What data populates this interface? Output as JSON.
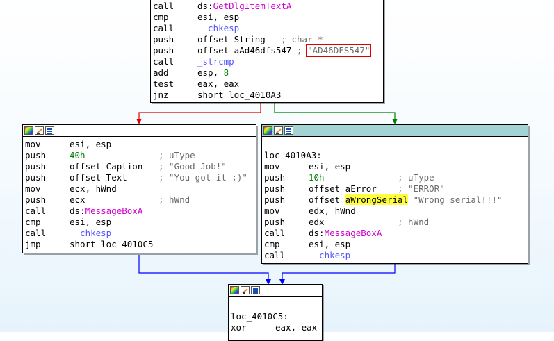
{
  "top_block": {
    "lines": [
      {
        "mn": "call",
        "op": "ds:",
        "opfn": "GetDlgItemTextA"
      },
      {
        "mn": "cmp",
        "op": "esi, esp"
      },
      {
        "mn": "call",
        "oplnk": "__chkesp"
      },
      {
        "mn": "push",
        "op": "offset String   ",
        "cm": "; char *"
      },
      {
        "mn": "push",
        "op": "offset aAd46dfs547 ",
        "cm": ";",
        "cm2": "\"AD46DFS547\""
      },
      {
        "mn": "call",
        "oplnk": "_strcmp"
      },
      {
        "mn": "add",
        "op": "esp, ",
        "num": "8"
      },
      {
        "mn": "test",
        "op": "eax, eax"
      },
      {
        "mn": "jnz",
        "op": "short loc_4010A3"
      }
    ]
  },
  "left_block": {
    "lines": [
      {
        "mn": "mov",
        "op": "esi, esp"
      },
      {
        "mn": "push",
        "num": "40h",
        "cm": "; uType"
      },
      {
        "mn": "push",
        "op": "offset Caption",
        "cm": "; \"Good Job!\""
      },
      {
        "mn": "push",
        "op": "offset Text",
        "cm": "; \"You got it ;)\""
      },
      {
        "mn": "mov",
        "op": "ecx, hWnd"
      },
      {
        "mn": "push",
        "op": "ecx",
        "cm": "; hWnd"
      },
      {
        "mn": "call",
        "op": "ds:",
        "opfn": "MessageBoxA"
      },
      {
        "mn": "cmp",
        "op": "esi, esp"
      },
      {
        "mn": "call",
        "oplnk": "__chkesp"
      },
      {
        "mn": "jmp",
        "op": "short loc_4010C5"
      }
    ]
  },
  "right_block": {
    "label": "loc_4010A3:",
    "lines": [
      {
        "mn": "mov",
        "op": "esi, esp"
      },
      {
        "mn": "push",
        "num": "10h",
        "cm": "; uType"
      },
      {
        "mn": "push",
        "op": "offset aError",
        "cm": "; \"ERROR\""
      },
      {
        "mn": "push",
        "op": "offset ",
        "ophl": "aWrongSerial",
        "cm": " ; \"Wrong serial!!!\""
      },
      {
        "mn": "mov",
        "op": "edx, hWnd"
      },
      {
        "mn": "push",
        "op": "edx",
        "cm": "; hWnd"
      },
      {
        "mn": "call",
        "op": "ds:",
        "opfn": "MessageBoxA"
      },
      {
        "mn": "cmp",
        "op": "esi, esp"
      },
      {
        "mn": "call",
        "oplnk": "__chkesp"
      }
    ]
  },
  "bottom_block": {
    "label": "loc_4010C5:",
    "lines": [
      {
        "mn": "xor",
        "op": "eax, eax"
      }
    ]
  },
  "colors": {
    "edge_false": "#e00000",
    "edge_true": "#008000",
    "edge_jump": "#0000ff",
    "highlight": "#ffff40",
    "header_teal": "#a4d3d3"
  },
  "icons": [
    "graph-color-icon",
    "edit-icon",
    "graph-view-icon"
  ]
}
